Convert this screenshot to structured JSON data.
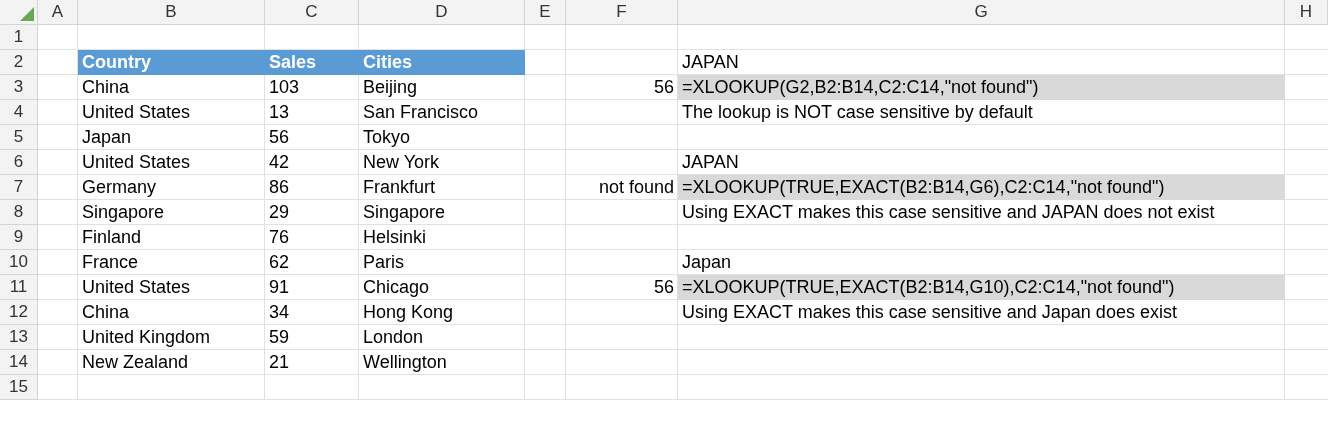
{
  "columns": [
    "A",
    "B",
    "C",
    "D",
    "E",
    "F",
    "G",
    "H"
  ],
  "rows": [
    {
      "number": "1",
      "cells": [
        null,
        null,
        null,
        null,
        null,
        null,
        null,
        null
      ]
    },
    {
      "number": "2",
      "cells": [
        null,
        {
          "text": "Country",
          "kind": "header"
        },
        {
          "text": "Sales",
          "kind": "header"
        },
        {
          "text": "Cities",
          "kind": "header"
        },
        null,
        null,
        {
          "text": "JAPAN",
          "kind": "plain"
        },
        null
      ]
    },
    {
      "number": "3",
      "cells": [
        null,
        {
          "text": "China",
          "kind": "plain"
        },
        {
          "text": "103",
          "kind": "plain"
        },
        {
          "text": "Beijing",
          "kind": "plain"
        },
        null,
        {
          "text": "56",
          "kind": "result"
        },
        {
          "text": "=XLOOKUP(G2,B2:B14,C2:C14,\"not found\")",
          "kind": "formula"
        },
        null
      ]
    },
    {
      "number": "4",
      "cells": [
        null,
        {
          "text": "United States",
          "kind": "plain"
        },
        {
          "text": "13",
          "kind": "plain"
        },
        {
          "text": "San Francisco",
          "kind": "plain"
        },
        null,
        null,
        {
          "text": "The lookup is NOT case sensitive by default",
          "kind": "plain"
        },
        null
      ]
    },
    {
      "number": "5",
      "cells": [
        null,
        {
          "text": "Japan",
          "kind": "plain"
        },
        {
          "text": "56",
          "kind": "plain"
        },
        {
          "text": "Tokyo",
          "kind": "plain"
        },
        null,
        null,
        null,
        null
      ]
    },
    {
      "number": "6",
      "cells": [
        null,
        {
          "text": "United States",
          "kind": "plain"
        },
        {
          "text": "42",
          "kind": "plain"
        },
        {
          "text": "New York",
          "kind": "plain"
        },
        null,
        null,
        {
          "text": "JAPAN",
          "kind": "plain"
        },
        null
      ]
    },
    {
      "number": "7",
      "cells": [
        null,
        {
          "text": "Germany",
          "kind": "plain"
        },
        {
          "text": "86",
          "kind": "plain"
        },
        {
          "text": "Frankfurt",
          "kind": "plain"
        },
        null,
        {
          "text": "not found",
          "kind": "result"
        },
        {
          "text": "=XLOOKUP(TRUE,EXACT(B2:B14,G6),C2:C14,\"not found\")",
          "kind": "formula"
        },
        null
      ]
    },
    {
      "number": "8",
      "cells": [
        null,
        {
          "text": "Singapore",
          "kind": "plain"
        },
        {
          "text": "29",
          "kind": "plain"
        },
        {
          "text": "Singapore",
          "kind": "plain"
        },
        null,
        null,
        {
          "text": "Using EXACT makes this case sensitive and JAPAN does not exist",
          "kind": "plain"
        },
        null
      ]
    },
    {
      "number": "9",
      "cells": [
        null,
        {
          "text": "Finland",
          "kind": "plain"
        },
        {
          "text": "76",
          "kind": "plain"
        },
        {
          "text": "Helsinki",
          "kind": "plain"
        },
        null,
        null,
        null,
        null
      ]
    },
    {
      "number": "10",
      "cells": [
        null,
        {
          "text": "France",
          "kind": "plain"
        },
        {
          "text": "62",
          "kind": "plain"
        },
        {
          "text": "Paris",
          "kind": "plain"
        },
        null,
        null,
        {
          "text": "Japan",
          "kind": "plain"
        },
        null
      ]
    },
    {
      "number": "11",
      "cells": [
        null,
        {
          "text": "United States",
          "kind": "plain"
        },
        {
          "text": "91",
          "kind": "plain"
        },
        {
          "text": "Chicago",
          "kind": "plain"
        },
        null,
        {
          "text": "56",
          "kind": "result"
        },
        {
          "text": "=XLOOKUP(TRUE,EXACT(B2:B14,G10),C2:C14,\"not found\")",
          "kind": "formula"
        },
        null
      ]
    },
    {
      "number": "12",
      "cells": [
        null,
        {
          "text": "China",
          "kind": "plain"
        },
        {
          "text": "34",
          "kind": "plain"
        },
        {
          "text": "Hong Kong",
          "kind": "plain"
        },
        null,
        null,
        {
          "text": "Using EXACT makes this case sensitive and Japan does exist",
          "kind": "plain"
        },
        null
      ]
    },
    {
      "number": "13",
      "cells": [
        null,
        {
          "text": "United Kingdom",
          "kind": "plain"
        },
        {
          "text": "59",
          "kind": "plain"
        },
        {
          "text": "London",
          "kind": "plain"
        },
        null,
        null,
        null,
        null
      ]
    },
    {
      "number": "14",
      "cells": [
        null,
        {
          "text": "New Zealand",
          "kind": "plain"
        },
        {
          "text": "21",
          "kind": "plain"
        },
        {
          "text": "Wellington",
          "kind": "plain"
        },
        null,
        null,
        null,
        null
      ]
    },
    {
      "number": "15",
      "cells": [
        null,
        null,
        null,
        null,
        null,
        null,
        null,
        null
      ]
    }
  ]
}
